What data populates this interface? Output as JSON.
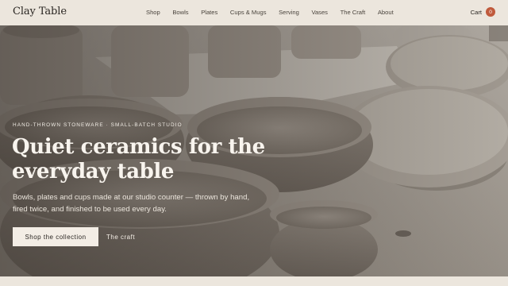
{
  "brand": {
    "name": "Clay Table"
  },
  "nav": {
    "items": [
      {
        "label": "Shop"
      },
      {
        "label": "Bowls"
      },
      {
        "label": "Plates"
      },
      {
        "label": "Cups & Mugs"
      },
      {
        "label": "Serving"
      },
      {
        "label": "Vases"
      },
      {
        "label": "The Craft"
      },
      {
        "label": "About"
      }
    ]
  },
  "cart": {
    "label": "Cart",
    "count": "0"
  },
  "hero": {
    "eyebrow": "HAND-THROWN STONEWARE · SMALL-BATCH STUDIO",
    "headline": "Quiet ceramics for the everyday table",
    "subtext": "Bowls, plates and cups made at our studio counter — thrown by hand, fired twice, and finished to be used every day.",
    "primary_cta": "Shop the collection",
    "secondary_cta": "The craft"
  },
  "colors": {
    "accent": "#c05a3c",
    "background": "#ece6dd",
    "text": "#2a2622"
  }
}
